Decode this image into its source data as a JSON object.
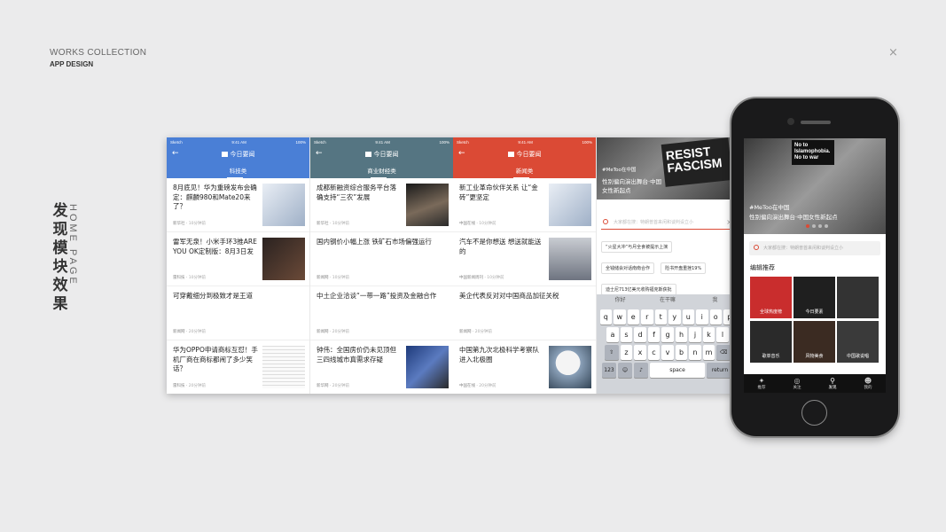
{
  "header": {
    "line1": "WORKS COLLECTION",
    "line2": "APP DESIGN",
    "close_glyph": "×"
  },
  "vertical_title": {
    "chars": [
      "发",
      "现",
      "模",
      "块",
      "效",
      "果"
    ],
    "subtitle": "HOME PAGE"
  },
  "status": {
    "carrier": "Sketch",
    "time": "9:41 AM",
    "battery": "100%"
  },
  "screens": [
    {
      "nav_title": "今日要闻",
      "category": "科技类",
      "articles": [
        {
          "title": "8月底见！华为重磅发布会确定：麒麟980和Mate20来了？",
          "source": "新华社",
          "time": "10分钟前"
        },
        {
          "title": "雷军无泉！小米手环3推ARE YOU OK定制版：8月3日发",
          "source": "雷科技",
          "time": "10分钟前"
        },
        {
          "title": "可穿戴细分到极致才是王道",
          "source": "新闻网",
          "time": "20分钟前"
        },
        {
          "title": "华为OPPO申请商标互怼！手机厂商在商标都闹了多少笑话？",
          "source": "雷科技",
          "time": "20分钟前"
        }
      ]
    },
    {
      "nav_title": "今日要闻",
      "category": "商业财经类",
      "articles": [
        {
          "title": "成都新融资综合服务平台落确支持“三农”发展",
          "source": "新华社",
          "time": "10分钟前"
        },
        {
          "title": "国内钢价小幅上涨 铁矿石市场偏强运行",
          "source": "新闻网",
          "time": "10分钟前"
        },
        {
          "title": "中土企业洽谈“一带一路”投资及金融合作",
          "source": "新闻网",
          "time": "20分钟前"
        },
        {
          "title": "钟伟：全国房价仍未见顶但三四线城市真需求存疑",
          "source": "新华网",
          "time": "20分钟前"
        }
      ]
    },
    {
      "nav_title": "今日要闻",
      "category": "新闻类",
      "articles": [
        {
          "title": "新工业革命伙伴关系 让“金砖”更坚定",
          "source": "中国在线",
          "time": "10分钟前"
        },
        {
          "title": "汽车不是你想送  想送就能送的",
          "source": "中国新闻周刊",
          "time": "10分钟前"
        },
        {
          "title": "美企代表反对对中国商品加征关税",
          "source": "新闻网",
          "time": "20分钟前"
        },
        {
          "title": "中国第九次北极科学考察队进入北极圈",
          "source": "中国在线",
          "time": "20分钟前"
        }
      ]
    }
  ],
  "search_screen": {
    "hero_caption_tag": "#MeToo在中国",
    "hero_caption": "性别偏向演出舞台·中国女性新起点",
    "sign_text": "RESIST FASCISM",
    "placeholder": "大家都在搜：特朗普首来闲和谈判设立小",
    "suggestions": [
      "“火星大冲”与月全食被提示上演",
      "全钱储会对话南南合作",
      "险书开盘重挫19%",
      "迪士尼713亿美元收购福克斯获批"
    ],
    "predictions": [
      "你好",
      "在干嘛",
      "我"
    ],
    "keyboard_rows": [
      [
        "q",
        "w",
        "e",
        "r",
        "t",
        "y",
        "u",
        "i",
        "o",
        "p"
      ],
      [
        "a",
        "s",
        "d",
        "f",
        "g",
        "h",
        "j",
        "k",
        "l"
      ],
      [
        "z",
        "x",
        "c",
        "v",
        "b",
        "n",
        "m"
      ]
    ],
    "key_123": "123",
    "key_space": "space",
    "key_return": "return"
  },
  "phone_screen": {
    "hero_tag": "#MeToo在中国",
    "hero_caption": "性别偏向演出舞台·中国女性新起点",
    "sign_text": "No to Islamophobia. No to war",
    "placeholder": "大家都在搜：特朗普首来闲和谈判设立小",
    "section_title": "编辑推荐",
    "tiles": [
      {
        "label": "全球热度榜",
        "color": "#c92d2d"
      },
      {
        "label": "今日要素",
        "color": "#1f1f1f"
      },
      {
        "label": "",
        "color": "#333333"
      },
      {
        "label": "歌单音乐",
        "color": "#2a2a2a"
      },
      {
        "label": "风物美食",
        "color": "#3b2b22"
      },
      {
        "label": "中国歌说唱",
        "color": "#3a3a3a"
      }
    ],
    "tabs": [
      {
        "label": "推荐",
        "icon": "logo-icon"
      },
      {
        "label": "关注",
        "icon": "compass-icon"
      },
      {
        "label": "发现",
        "icon": "search-icon"
      },
      {
        "label": "我的",
        "icon": "user-icon"
      }
    ]
  },
  "colors": {
    "blue": "#4a7fd6",
    "slate": "#557582",
    "red": "#db4a35"
  }
}
